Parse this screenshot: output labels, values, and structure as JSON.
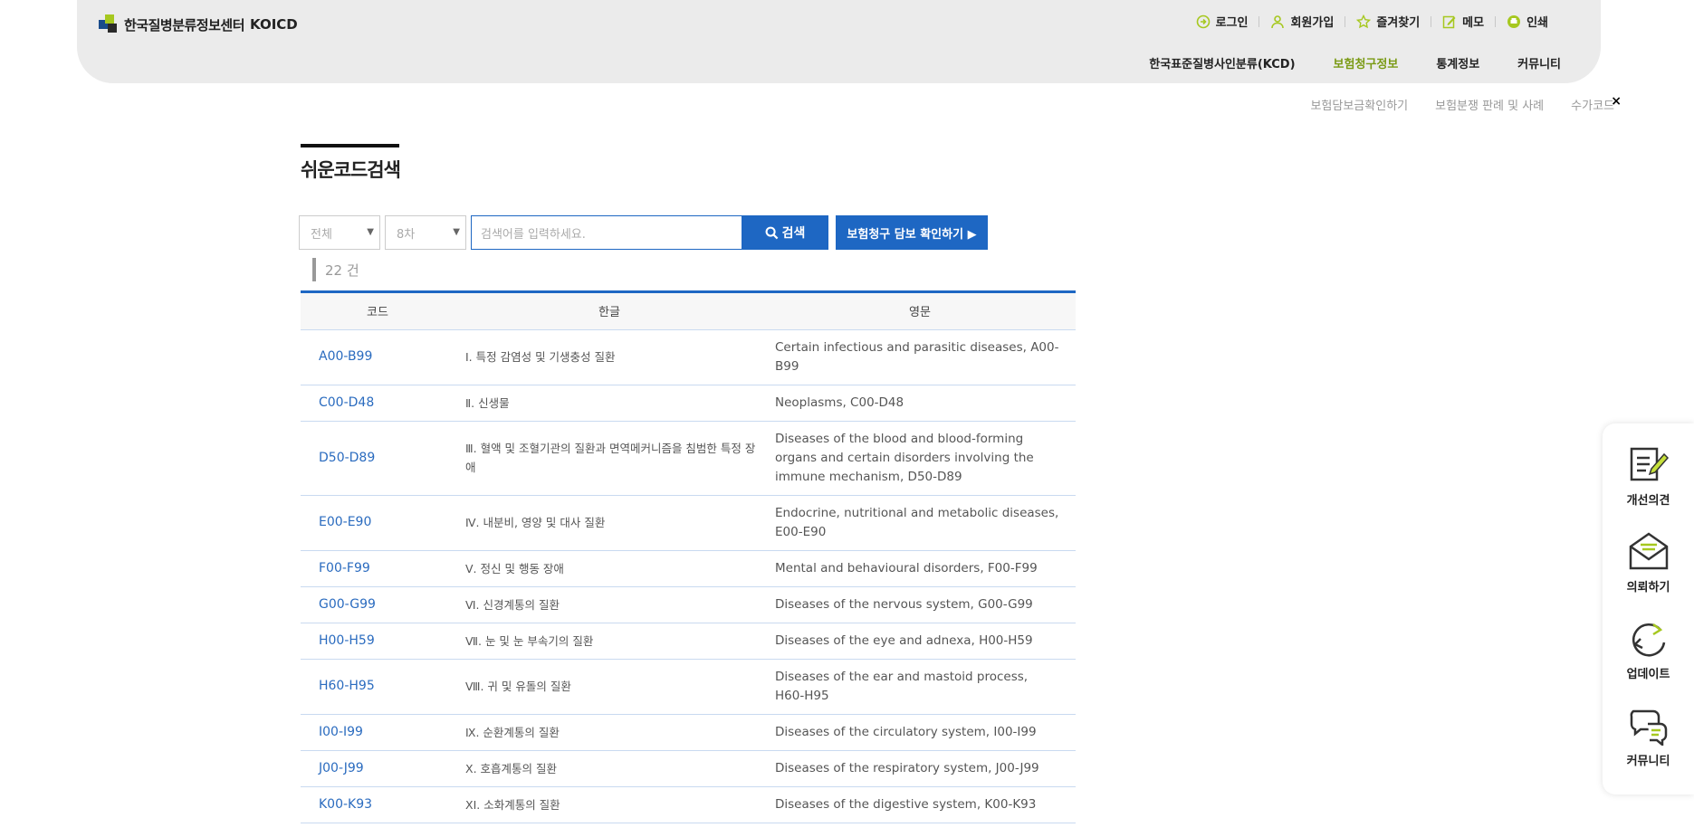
{
  "header": {
    "logo_text": "한국질병분류정보센터",
    "logo_brand": "KOICD",
    "util": [
      {
        "label": "로그인",
        "icon": "login-icon"
      },
      {
        "label": "회원가입",
        "icon": "user-icon"
      },
      {
        "label": "즐겨찾기",
        "icon": "star-icon"
      },
      {
        "label": "메모",
        "icon": "memo-icon"
      },
      {
        "label": "인쇄",
        "icon": "print-icon"
      }
    ],
    "gnb": [
      "한국표준질병사인분류(KCD)",
      "보험청구정보",
      "통계정보",
      "커뮤니티"
    ],
    "gnb_active": "보험청구정보",
    "subnav": [
      "보험담보금확인하기",
      "보험분쟁 판례 및 사례",
      "수가코드"
    ],
    "subnav_close": "×"
  },
  "page_title": "쉬운코드검색",
  "search": {
    "select_scope": "전체",
    "select_version": "8차",
    "placeholder": "검색어를 입력하세요.",
    "button": "검색",
    "check_button": "보험청구 담보 확인하기 ▶"
  },
  "result_count": "22 건",
  "table": {
    "headers": [
      "코드",
      "한글",
      "영문"
    ],
    "rows": [
      {
        "code": "A00-B99",
        "ko": "I. 특정 감염성 및 기생충성 질환",
        "en": "Certain infectious and parasitic diseases, A00-B99"
      },
      {
        "code": "C00-D48",
        "ko": "Ⅱ. 신생물",
        "en": "Neoplasms, C00-D48"
      },
      {
        "code": "D50-D89",
        "ko": "Ⅲ. 혈액 및 조혈기관의 질환과 면역메커니즘을 침범한 특정 장애",
        "en": "Diseases of the blood and blood-forming organs and certain disorders involving the immune mechanism, D50-D89"
      },
      {
        "code": "E00-E90",
        "ko": "Ⅳ. 내분비, 영양 및 대사 질환",
        "en": "Endocrine, nutritional and metabolic diseases, E00-E90"
      },
      {
        "code": "F00-F99",
        "ko": "Ⅴ. 정신 및 행동 장애",
        "en": "Mental and behavioural disorders, F00-F99"
      },
      {
        "code": "G00-G99",
        "ko": "Ⅵ. 신경계통의 질환",
        "en": "Diseases of the nervous system, G00-G99"
      },
      {
        "code": "H00-H59",
        "ko": "Ⅶ. 눈 및 눈 부속기의 질환",
        "en": "Diseases of the eye and adnexa, H00-H59"
      },
      {
        "code": "H60-H95",
        "ko": "Ⅷ. 귀 및 유돌의 질환",
        "en": "Diseases of the ear and mastoid process, H60-H95"
      },
      {
        "code": "I00-I99",
        "ko": "Ⅸ. 순환계통의 질환",
        "en": "Diseases of the circulatory system, I00-I99"
      },
      {
        "code": "J00-J99",
        "ko": "Ⅹ. 호흡계통의 질환",
        "en": "Diseases of the respiratory system, J00-J99"
      },
      {
        "code": "K00-K93",
        "ko": "ⅩⅠ. 소화계통의 질환",
        "en": "Diseases of the digestive system, K00-K93"
      }
    ]
  },
  "side_panel": [
    {
      "label": "개선의견",
      "icon": "feedback-icon"
    },
    {
      "label": "의뢰하기",
      "icon": "mail-icon"
    },
    {
      "label": "업데이트",
      "icon": "update-icon"
    },
    {
      "label": "커뮤니티",
      "icon": "chat-icon"
    }
  ],
  "colors": {
    "accent": "#1e67c3",
    "brand_green": "#a6c81f",
    "active_menu": "#7a9a14",
    "header_bg": "#ebebeb"
  }
}
